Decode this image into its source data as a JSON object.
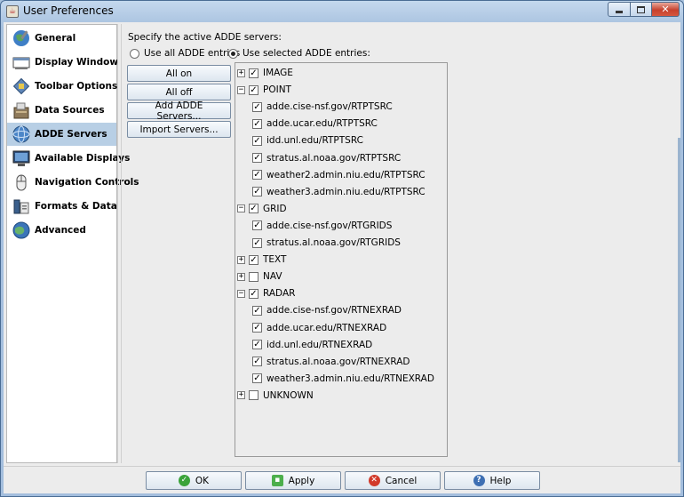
{
  "window": {
    "title": "User Preferences"
  },
  "sidebar": {
    "items": [
      {
        "label": "General",
        "icon": "globe-tool-icon",
        "selected": false
      },
      {
        "label": "Display Window",
        "icon": "display-window-icon",
        "selected": false
      },
      {
        "label": "Toolbar Options",
        "icon": "toolbar-options-icon",
        "selected": false
      },
      {
        "label": "Data Sources",
        "icon": "data-sources-icon",
        "selected": false
      },
      {
        "label": "ADDE Servers",
        "icon": "adde-globe-icon",
        "selected": true
      },
      {
        "label": "Available Displays",
        "icon": "monitor-icon",
        "selected": false
      },
      {
        "label": "Navigation Controls",
        "icon": "mouse-icon",
        "selected": false
      },
      {
        "label": "Formats & Data",
        "icon": "formats-data-icon",
        "selected": false
      },
      {
        "label": "Advanced",
        "icon": "advanced-globe-icon",
        "selected": false
      }
    ]
  },
  "main": {
    "heading": "Specify the active ADDE servers:",
    "radio_all": "Use all ADDE entries",
    "radio_selected": "Use selected ADDE entries:",
    "radio_value": "selected",
    "buttons": {
      "all_on": "All on",
      "all_off": "All off",
      "add": "Add ADDE Servers...",
      "import": "Import Servers..."
    },
    "tree": [
      {
        "level": 0,
        "label": "IMAGE",
        "expanded": false,
        "checked": true
      },
      {
        "level": 0,
        "label": "POINT",
        "expanded": true,
        "checked": true
      },
      {
        "level": 1,
        "label": "adde.cise-nsf.gov/RTPTSRC",
        "checked": true
      },
      {
        "level": 1,
        "label": "adde.ucar.edu/RTPTSRC",
        "checked": true
      },
      {
        "level": 1,
        "label": "idd.unl.edu/RTPTSRC",
        "checked": true
      },
      {
        "level": 1,
        "label": "stratus.al.noaa.gov/RTPTSRC",
        "checked": true
      },
      {
        "level": 1,
        "label": "weather2.admin.niu.edu/RTPTSRC",
        "checked": true
      },
      {
        "level": 1,
        "label": "weather3.admin.niu.edu/RTPTSRC",
        "checked": true
      },
      {
        "level": 0,
        "label": "GRID",
        "expanded": true,
        "checked": true
      },
      {
        "level": 1,
        "label": "adde.cise-nsf.gov/RTGRIDS",
        "checked": true
      },
      {
        "level": 1,
        "label": "stratus.al.noaa.gov/RTGRIDS",
        "checked": true
      },
      {
        "level": 0,
        "label": "TEXT",
        "expanded": false,
        "checked": true
      },
      {
        "level": 0,
        "label": "NAV",
        "expanded": false,
        "checked": false
      },
      {
        "level": 0,
        "label": "RADAR",
        "expanded": true,
        "checked": true
      },
      {
        "level": 1,
        "label": "adde.cise-nsf.gov/RTNEXRAD",
        "checked": true
      },
      {
        "level": 1,
        "label": "adde.ucar.edu/RTNEXRAD",
        "checked": true
      },
      {
        "level": 1,
        "label": "idd.unl.edu/RTNEXRAD",
        "checked": true
      },
      {
        "level": 1,
        "label": "stratus.al.noaa.gov/RTNEXRAD",
        "checked": true
      },
      {
        "level": 1,
        "label": "weather3.admin.niu.edu/RTNEXRAD",
        "checked": true
      },
      {
        "level": 0,
        "label": "UNKNOWN",
        "expanded": false,
        "checked": false
      }
    ]
  },
  "footer": {
    "ok": "OK",
    "apply": "Apply",
    "cancel": "Cancel",
    "help": "Help"
  },
  "colors": {
    "selection": "#b8cfe5",
    "ok_icon": "#3aa33a",
    "apply_icon": "#4caf4c",
    "cancel_icon": "#d23a2a",
    "help_icon": "#3d6fb3"
  }
}
